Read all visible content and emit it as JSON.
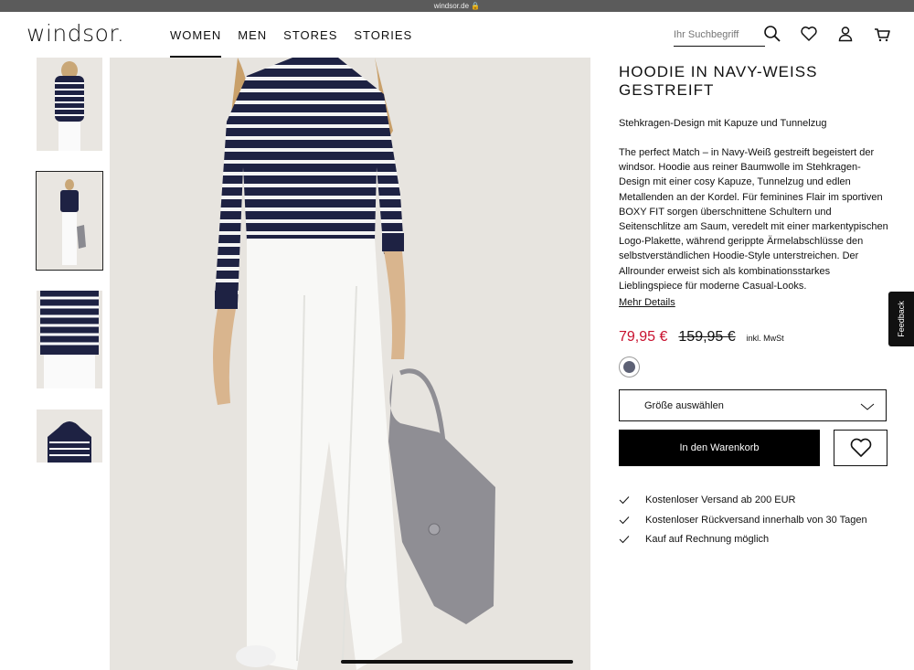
{
  "browser": {
    "url": "windsor.de"
  },
  "header": {
    "logo": "windsor.",
    "nav": [
      "WOMEN",
      "MEN",
      "STORES",
      "STORIES"
    ],
    "search_placeholder": "Ihr Suchbegriff"
  },
  "product": {
    "title": "HOODIE IN NAVY-WEISS GESTREIFT",
    "subtitle": "Stehkragen-Design mit Kapuze und Tunnelzug",
    "description": "The perfect Match – in Navy-Weiß gestreift begeistert der windsor. Hoodie aus reiner Baumwolle im Stehkragen-Design mit einer cosy Kapuze, Tunnelzug und edlen Metallenden an der Kordel. Für feminines Flair im sportiven BOXY FIT sorgen überschnittene Schultern und Seitenschlitze am Saum, veredelt mit einer markentypischen Logo-Plakette, während gerippte Ärmelabschlüsse den selbstverständlichen Hoodie-Style unterstreichen. Der Allrounder erweist sich als kombinationsstarkes Lieblingspiece für moderne Casual-Looks.",
    "more_details": "Mehr Details",
    "price": "79,95 €",
    "old_price": "159,95 €",
    "tax_note": "inkl. MwSt",
    "swatch_color": "#5c6074",
    "size_label": "Größe auswählen",
    "cart_label": "In den Warenkorb",
    "benefits": [
      "Kostenloser Versand ab 200 EUR",
      "Kostenloser Rückversand innerhalb von 30 Tagen",
      "Kauf auf Rechnung möglich"
    ]
  },
  "feedback_label": "Feedback",
  "colors": {
    "price": "#c8102e",
    "navy": "#1e2243",
    "background": "#e7e4df"
  }
}
